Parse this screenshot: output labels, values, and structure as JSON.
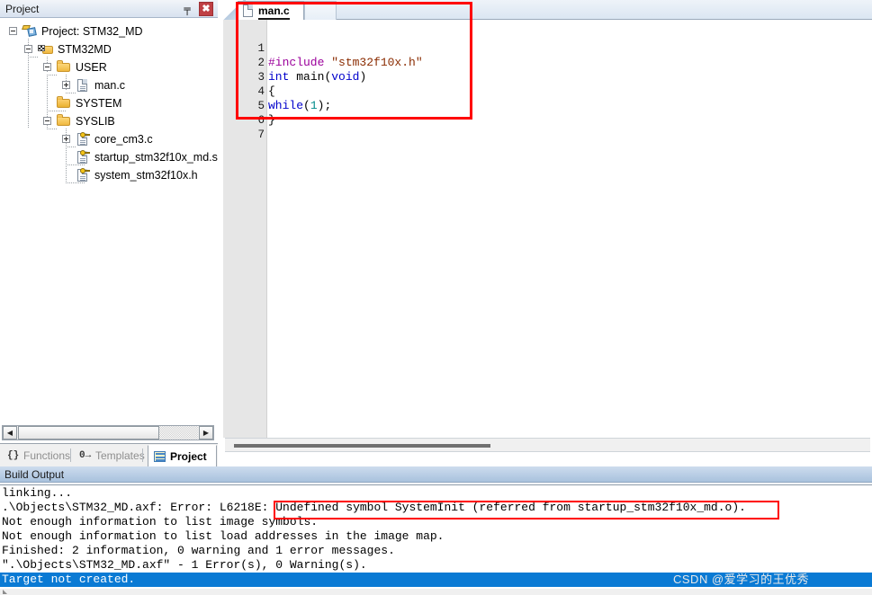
{
  "project_panel": {
    "title": "Project",
    "pin_icon": "pin-icon",
    "close_icon": "close-icon",
    "pin_glyph": "╤",
    "close_glyph": "✖",
    "tree": [
      {
        "label": "Project: STM32_MD",
        "icon": "project-icon",
        "indent": 0,
        "expander": "minus"
      },
      {
        "label": "STM32MD",
        "icon": "target-icon",
        "indent": 1,
        "expander": "minus"
      },
      {
        "label": "USER",
        "icon": "folder-icon",
        "indent": 2,
        "expander": "minus"
      },
      {
        "label": "man.c",
        "icon": "c-file-icon",
        "indent": 3,
        "expander": "plus"
      },
      {
        "label": "SYSTEM",
        "icon": "folder-icon",
        "indent": 2,
        "expander": "none"
      },
      {
        "label": "SYSLIB",
        "icon": "folder-icon",
        "indent": 2,
        "expander": "minus"
      },
      {
        "label": "core_cm3.c",
        "icon": "readonly-file-icon",
        "indent": 3,
        "expander": "plus"
      },
      {
        "label": "startup_stm32f10x_md.s",
        "icon": "readonly-file-icon",
        "indent": 3,
        "expander": "none"
      },
      {
        "label": "system_stm32f10x.h",
        "icon": "readonly-file-icon",
        "indent": 3,
        "expander": "none"
      }
    ],
    "hscroll": {
      "left_arrow": "◀",
      "right_arrow": "▶"
    },
    "tabs": [
      {
        "label": "Functions",
        "icon": "{}",
        "active": false
      },
      {
        "label": "Templates",
        "icon": "0→",
        "active": false
      },
      {
        "label": "Project",
        "icon": "project-tab-icon",
        "active": true
      }
    ]
  },
  "editor": {
    "tab": {
      "label": "man.c",
      "icon": "c-file-icon"
    },
    "lines": [
      {
        "no": "1",
        "tokens": [
          {
            "t": "#include ",
            "c": "tok-pp"
          },
          {
            "t": "\"stm32f10x.h\"",
            "c": "tok-str"
          }
        ]
      },
      {
        "no": "2",
        "tokens": [
          {
            "t": "int ",
            "c": "tok-ty"
          },
          {
            "t": "main",
            "c": "tok-id"
          },
          {
            "t": "(",
            "c": "tok-pun"
          },
          {
            "t": "void",
            "c": "tok-kw"
          },
          {
            "t": ")",
            "c": "tok-pun"
          }
        ]
      },
      {
        "no": "3",
        "tokens": [
          {
            "t": "{",
            "c": "tok-pun"
          }
        ]
      },
      {
        "no": "4",
        "tokens": [
          {
            "t": "while",
            "c": "tok-kw"
          },
          {
            "t": "(",
            "c": "tok-pun"
          },
          {
            "t": "1",
            "c": "tok-num"
          },
          {
            "t": ");",
            "c": "tok-pun"
          }
        ]
      },
      {
        "no": "5",
        "tokens": [
          {
            "t": "}",
            "c": "tok-pun"
          }
        ]
      },
      {
        "no": "6",
        "tokens": []
      },
      {
        "no": "7",
        "tokens": []
      }
    ]
  },
  "build_output": {
    "header": "Build Output",
    "lines": [
      {
        "text": "linking...",
        "selected": false
      },
      {
        "text": ".\\Objects\\STM32_MD.axf: Error: L6218E: Undefined symbol SystemInit (referred from startup_stm32f10x_md.o).",
        "selected": false
      },
      {
        "text": "Not enough information to list image symbols.",
        "selected": false
      },
      {
        "text": "Not enough information to list load addresses in the image map.",
        "selected": false
      },
      {
        "text": "Finished: 2 information, 0 warning and 1 error messages.",
        "selected": false
      },
      {
        "text": "\".\\Objects\\STM32_MD.axf\" - 1 Error(s), 0 Warning(s).",
        "selected": false
      },
      {
        "text": "Target not created.",
        "selected": true
      }
    ]
  },
  "annotations": [
    {
      "name": "editor-highlight-box",
      "color": "#ff0000"
    },
    {
      "name": "error-highlight-box",
      "color": "#ff0000"
    }
  ],
  "watermark": "CSDN @爱学习的王优秀"
}
